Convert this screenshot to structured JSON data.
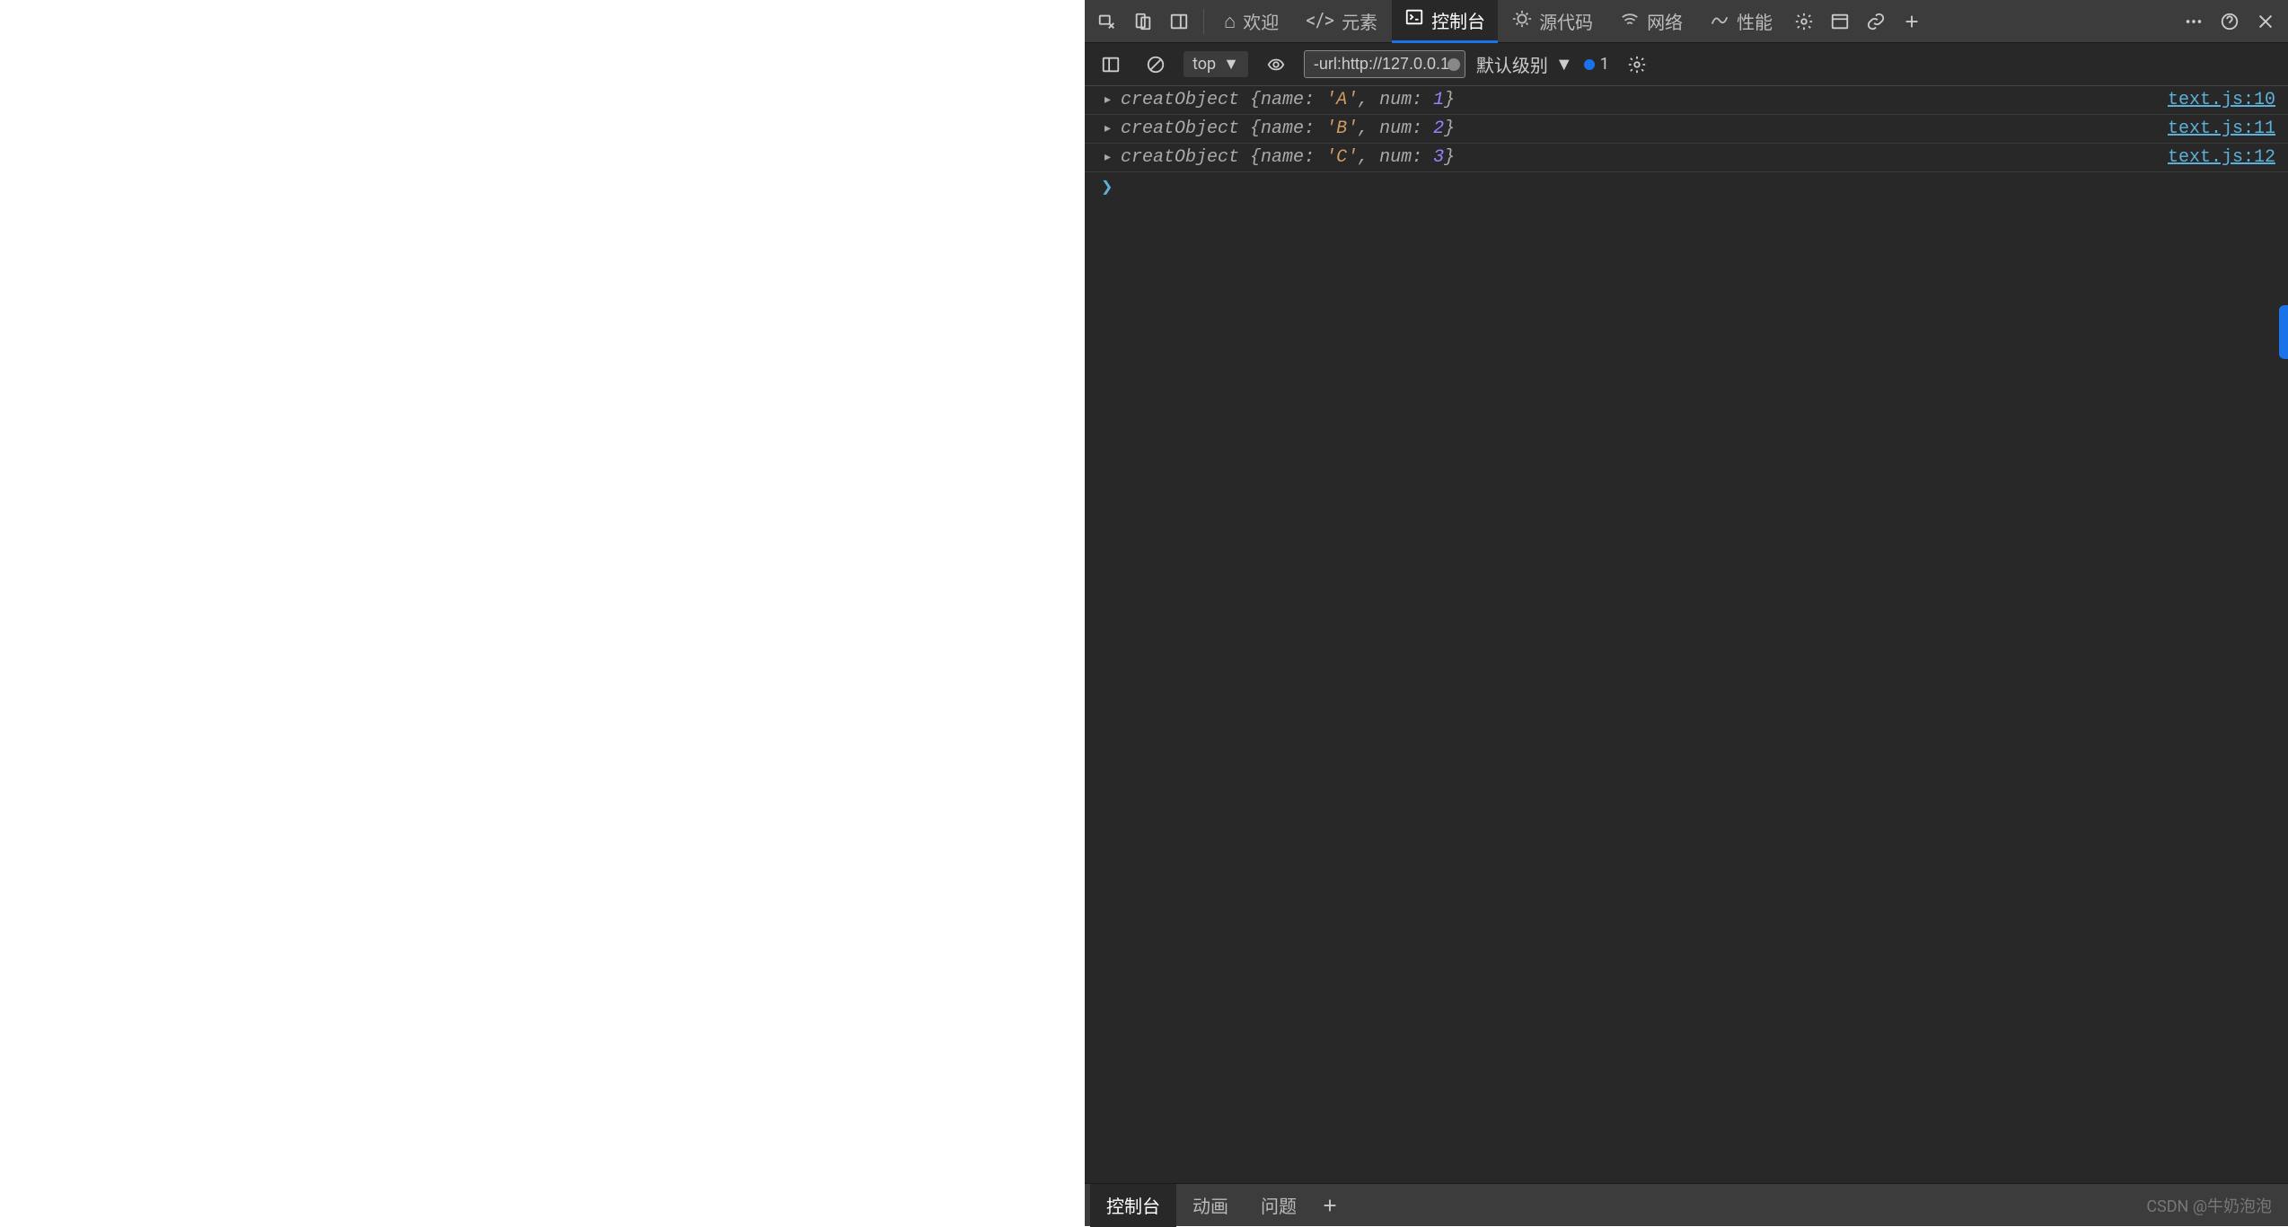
{
  "toolbar": {
    "tabs": {
      "welcome": "欢迎",
      "elements": "元素",
      "console": "控制台",
      "sources": "源代码",
      "network": "网络",
      "performance": "性能"
    }
  },
  "subtoolbar": {
    "context": "top",
    "filter_value": "-url:http://127.0.0.1",
    "levels": "默认级别",
    "issues_count": "1"
  },
  "logs": [
    {
      "class": "creatObject",
      "name": "'A'",
      "num": "1",
      "source": "text.js:10"
    },
    {
      "class": "creatObject",
      "name": "'B'",
      "num": "2",
      "source": "text.js:11"
    },
    {
      "class": "creatObject",
      "name": "'C'",
      "num": "3",
      "source": "text.js:12"
    }
  ],
  "drawer": {
    "tabs": {
      "console": "控制台",
      "animations": "动画",
      "issues": "问题"
    }
  },
  "watermark": "CSDN @牛奶泡泡"
}
